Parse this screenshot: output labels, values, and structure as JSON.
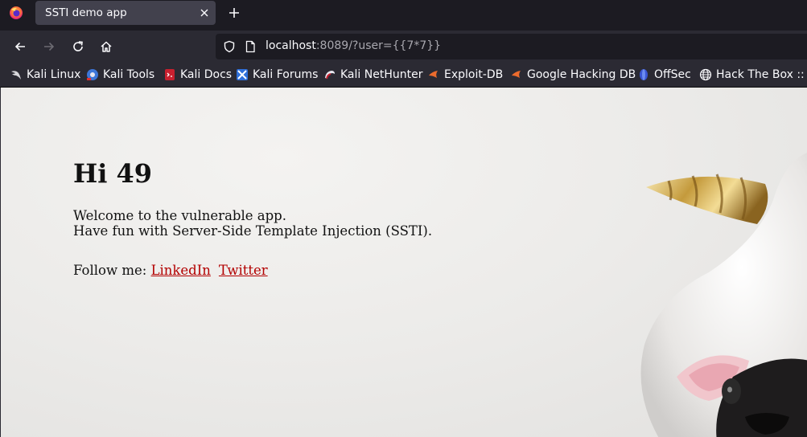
{
  "browser": {
    "tab": {
      "title": "SSTI demo app"
    },
    "url": {
      "host": "localhost",
      "rest": ":8089/?user={{7*7}}"
    },
    "bookmarks": [
      {
        "label": "Kali Linux",
        "icon": "kali-dragon-icon"
      },
      {
        "label": "Kali Tools",
        "icon": "kali-tools-icon"
      },
      {
        "label": "Kali Docs",
        "icon": "kali-docs-icon"
      },
      {
        "label": "Kali Forums",
        "icon": "kali-forums-icon"
      },
      {
        "label": "Kali NetHunter",
        "icon": "kali-nethunter-icon"
      },
      {
        "label": "Exploit-DB",
        "icon": "exploit-db-icon"
      },
      {
        "label": "Google Hacking DB",
        "icon": "ghdb-icon"
      },
      {
        "label": "OffSec",
        "icon": "offsec-icon"
      },
      {
        "label": "Hack The Box :: Lo",
        "icon": "globe-icon"
      }
    ]
  },
  "page": {
    "greeting": "Hi 49",
    "welcome_line1": "Welcome to the vulnerable app.",
    "welcome_line2": "Have fun with Server-Side Template Injection (SSTI).",
    "follow_label": "Follow me:",
    "links": {
      "linkedin": "LinkedIn",
      "twitter": "Twitter"
    },
    "image": "unicorn-horn-pug-photo"
  },
  "colors": {
    "tab_active": "#42414d",
    "toolbar": "#2b2a33",
    "urlbar": "#1c1b22",
    "link": "#b30000"
  }
}
